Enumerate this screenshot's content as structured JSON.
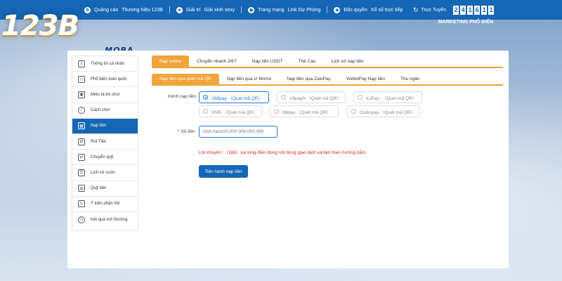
{
  "topbar": {
    "links": [
      {
        "icon": "gear-icon",
        "label": "Quảng cáo"
      },
      {
        "icon": "",
        "label": "Thương hiệu 123B"
      },
      {
        "icon": "trophy-icon",
        "label": "Giải trí"
      },
      {
        "icon": "",
        "label": "Giải xinh sexy"
      },
      {
        "icon": "globe-icon",
        "label": "Trang mạng"
      },
      {
        "icon": "",
        "label": "Link Dự Phòng"
      },
      {
        "icon": "shield-icon",
        "label": "Độc quyền"
      },
      {
        "icon": "",
        "label": "Xổ số trực tiếp"
      }
    ],
    "live_label": "Trực Tuyến",
    "live_digits": [
      "2",
      "4",
      "1",
      "6",
      "1",
      "1"
    ],
    "marquee": "MARKETING PHỔ BIẾN"
  },
  "logo": {
    "main": "123B",
    "sub": ".MOBA"
  },
  "sidebar": {
    "items": [
      {
        "icon": "user-card-icon",
        "label": "Thông tin cá nhân",
        "active": false
      },
      {
        "icon": "diamond-icon",
        "label": "Phổ biến toàn quốc",
        "active": false
      },
      {
        "icon": "gamepad-icon",
        "label": "Miêu tả trò chơi",
        "active": false
      },
      {
        "icon": "info-icon",
        "label": "Cách chơi",
        "active": false
      },
      {
        "icon": "deposit-icon",
        "label": "Nạp tiền",
        "active": true
      },
      {
        "icon": "withdraw-icon",
        "label": "Rút Tiền",
        "active": false
      },
      {
        "icon": "transfer-icon",
        "label": "Chuyển quỹ",
        "active": false
      },
      {
        "icon": "history-icon",
        "label": "Lịch sử cược",
        "active": false
      },
      {
        "icon": "fund-icon",
        "label": "Quỹ tiền",
        "active": false
      },
      {
        "icon": "feedback-icon",
        "label": "Ý kiến phản hồi",
        "active": false
      },
      {
        "icon": "clock-icon",
        "label": "Kết quả mở thưởng",
        "active": false
      }
    ]
  },
  "tabs_main": [
    {
      "label": "Nạp online",
      "active": true
    },
    {
      "label": "Chuyển nhanh 24/7",
      "active": false
    },
    {
      "label": "Nạp tiền USDT",
      "active": false
    },
    {
      "label": "Thẻ Cào",
      "active": false
    },
    {
      "label": "Lịch sử nạp tiền",
      "active": false
    }
  ],
  "tabs_sub": [
    {
      "label": "Nạp tiền qua quét mã QR",
      "active": true
    },
    {
      "label": "Nạp tiền qua ví Momo",
      "active": false
    },
    {
      "label": "Nạp tiền qua ZaloPay",
      "active": false
    },
    {
      "label": "ViettelPay Nạp tiền",
      "active": false
    },
    {
      "label": "Thu ngân",
      "active": false
    }
  ],
  "form": {
    "channel_label": "Kênh nạp tiền",
    "channels": [
      {
        "label": "168pay-（Quét mã QR）",
        "selected": true
      },
      {
        "label": "V8pay0-（Quét mã QR）",
        "selected": false
      },
      {
        "label": "XJPay -（Quét mã QR）",
        "selected": false
      },
      {
        "label": "VNR-（Quét mã QR）",
        "selected": false
      },
      {
        "label": "89pay-（Quét mã QR）",
        "selected": false
      },
      {
        "label": "Clubspay-（Quét mã QR）",
        "selected": false
      }
    ],
    "amount_label": "* Số tiền",
    "amount_placeholder": "Giới hạn100,000-300,000,000",
    "promo": "Lời khuyên：（16b）vui lòng điền đúng nội dung giao dịch và làm theo hướng dẫn!",
    "submit_label": "Tiến hành nạp tiền"
  }
}
